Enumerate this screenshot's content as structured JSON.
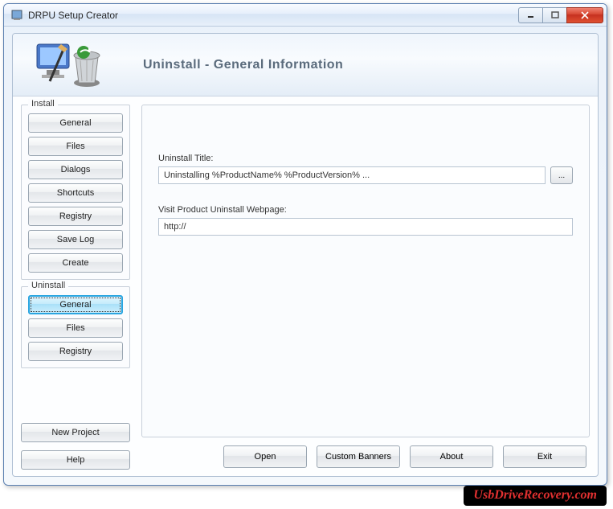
{
  "window": {
    "title": "DRPU Setup Creator"
  },
  "header": {
    "page_title": "Uninstall - General Information"
  },
  "sidebar": {
    "install_group": "Install",
    "install_items": [
      "General",
      "Files",
      "Dialogs",
      "Shortcuts",
      "Registry",
      "Save Log",
      "Create"
    ],
    "uninstall_group": "Uninstall",
    "uninstall_items": [
      "General",
      "Files",
      "Registry"
    ],
    "new_project": "New Project",
    "help": "Help"
  },
  "form": {
    "uninstall_title_label": "Uninstall Title:",
    "uninstall_title_value": "Uninstalling %ProductName% %ProductVersion% ...",
    "browse_label": "...",
    "webpage_label": "Visit Product Uninstall Webpage:",
    "webpage_value": "http://"
  },
  "actions": {
    "open": "Open",
    "custom_banners": "Custom Banners",
    "about": "About",
    "exit": "Exit"
  },
  "watermark": "UsbDriveRecovery.com"
}
